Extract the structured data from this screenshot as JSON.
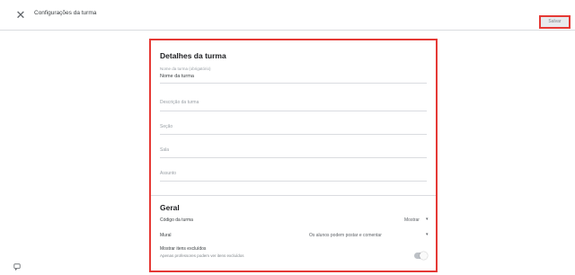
{
  "header": {
    "title": "Configurações da turma",
    "save_label": "Salvar"
  },
  "details": {
    "section_title": "Detalhes da turma",
    "name_label": "Nome da turma (obrigatório)",
    "name_value": "Nome da turma",
    "description_placeholder": "Descrição da turma",
    "section_placeholder": "Seção",
    "room_placeholder": "Sala",
    "subject_placeholder": "Assunto"
  },
  "general": {
    "section_title": "Geral",
    "invite_code_label": "Código da turma",
    "invite_code_value": "Mostrar",
    "stream_label": "Mural",
    "stream_value": "Os alunos podem postar e comentar",
    "notifications_label": "Mostrar itens excluídos",
    "notifications_sub": "Apenas professores podem ver itens excluídos",
    "toggle_on": false
  }
}
